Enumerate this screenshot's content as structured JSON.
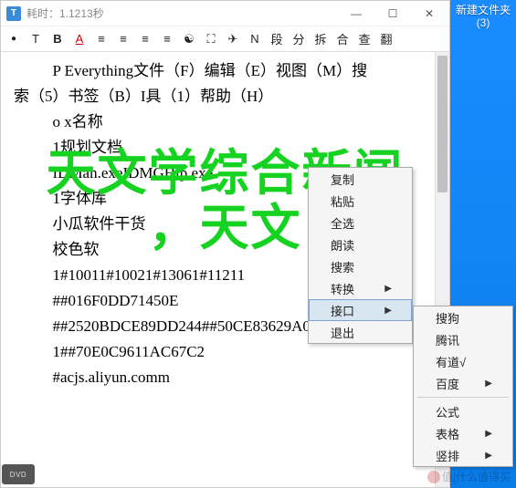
{
  "titlebar": {
    "icon_text": "T",
    "title": "耗时：1.1213秒"
  },
  "toolbar": {
    "items": [
      "T",
      "B",
      "A",
      "≡",
      "≡",
      "≡",
      "≡",
      "☯",
      "⛶",
      "✈",
      "N",
      "段",
      "分",
      "拆",
      "合",
      "查",
      "翻"
    ]
  },
  "lines": [
    "P   Everything文件（F）编辑（E）视图（M）搜",
    "索（5）书签（B）I具（1）帮助（H）",
    "o x名称",
    "1规划文档",
    "IDMan.exeIDMGHlp.exe",
    "1字体库",
    "小瓜软件干货",
    "校色软",
    "1#10011#10021#13061#11211",
    "##016F0DD71450E",
    "##2520BDCE89DD244##50CE83629A089CD",
    "1##70E0C9611AC67C2",
    "#acjs.aliyun.comm"
  ],
  "menu1": {
    "items": [
      {
        "label": "复制",
        "arrow": false
      },
      {
        "label": "粘贴",
        "arrow": false
      },
      {
        "label": "全选",
        "arrow": false
      },
      {
        "label": "朗读",
        "arrow": false
      },
      {
        "label": "搜索",
        "arrow": false
      },
      {
        "label": "转换",
        "arrow": true
      },
      {
        "label": "接口",
        "arrow": true,
        "hovered": true
      },
      {
        "label": "退出",
        "arrow": false
      }
    ]
  },
  "menu2": {
    "items": [
      {
        "label": "搜狗",
        "arrow": false
      },
      {
        "label": "腾讯",
        "arrow": false
      },
      {
        "label": "有道√",
        "arrow": false
      },
      {
        "label": "百度",
        "arrow": true
      },
      {
        "sep": true
      },
      {
        "label": "公式",
        "arrow": false
      },
      {
        "label": "表格",
        "arrow": true
      },
      {
        "label": "竖排",
        "arrow": true
      }
    ]
  },
  "desktop": {
    "folder_line1": "新建文件夹",
    "folder_line2": "(3)"
  },
  "overlay": {
    "line1": "天文学综合新闻",
    "line2": "，天文"
  },
  "watermark": "值|什么值得买",
  "dvd": "DVD"
}
